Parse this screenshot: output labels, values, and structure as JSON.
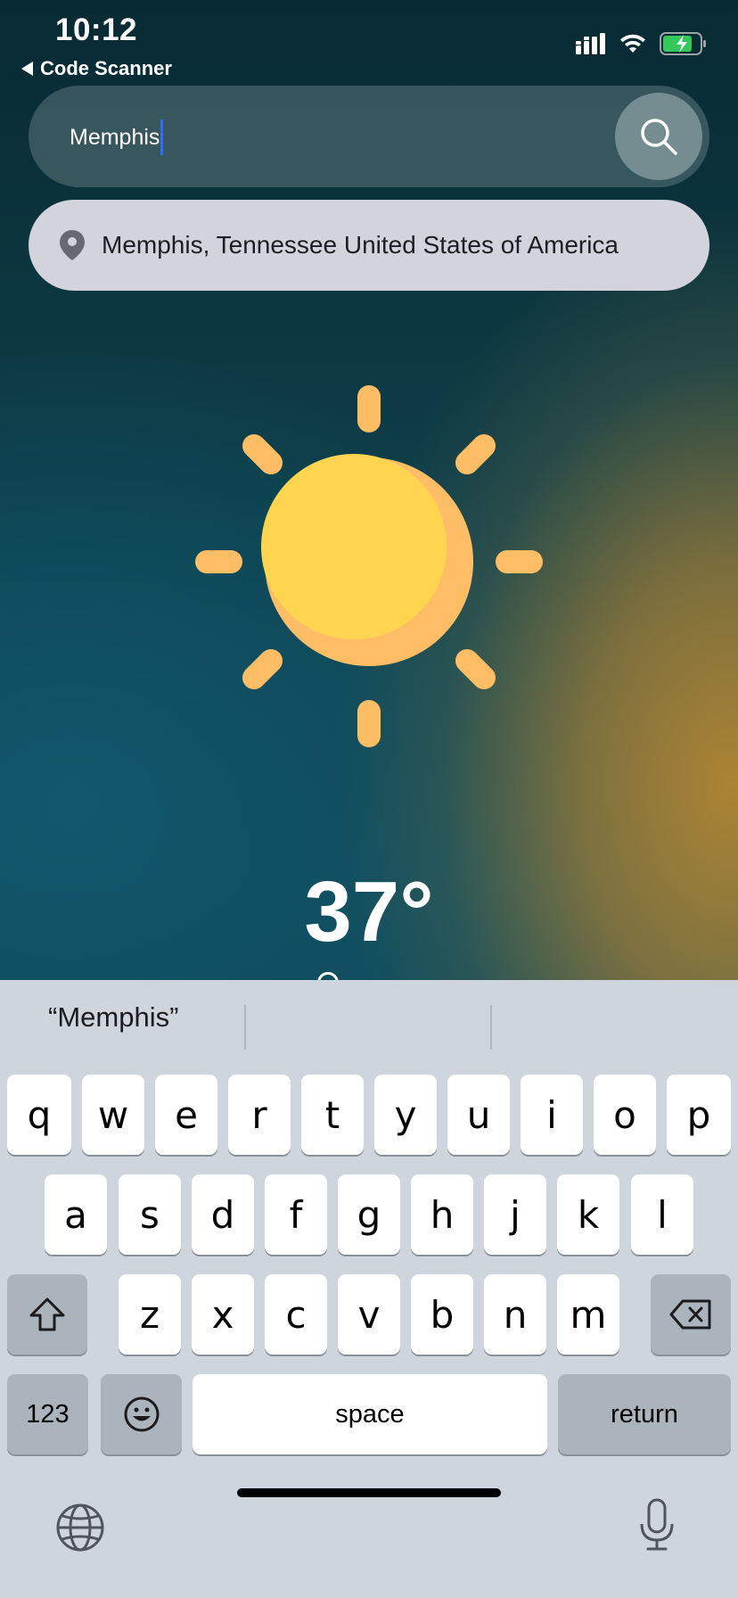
{
  "status_bar": {
    "time": "10:12",
    "back_label": "Code Scanner"
  },
  "search": {
    "value": "Memphis"
  },
  "suggestion": {
    "text": "Memphis, Tennessee United States of America"
  },
  "weather": {
    "temperature": "37°"
  },
  "keyboard": {
    "predictions": [
      "“Memphis”",
      "",
      ""
    ],
    "row1": [
      "q",
      "w",
      "e",
      "r",
      "t",
      "y",
      "u",
      "i",
      "o",
      "p"
    ],
    "row2": [
      "a",
      "s",
      "d",
      "f",
      "g",
      "h",
      "j",
      "k",
      "l"
    ],
    "row3": [
      "z",
      "x",
      "c",
      "v",
      "b",
      "n",
      "m"
    ],
    "numbers_label": "123",
    "space_label": "space",
    "return_label": "return"
  },
  "icons": {
    "signal": "cellular-signal-icon",
    "wifi": "wifi-icon",
    "battery": "battery-charging-icon",
    "search": "search-icon",
    "pin": "location-pin-icon",
    "sun": "sun-icon",
    "shift": "shift-icon",
    "delete": "delete-icon",
    "emoji": "emoji-icon",
    "globe": "globe-icon",
    "mic": "microphone-icon"
  },
  "colors": {
    "sun_core": "#ffd54f",
    "sun_rays": "#ffbe66",
    "battery_green": "#34c759",
    "caret": "#2f6cff"
  }
}
